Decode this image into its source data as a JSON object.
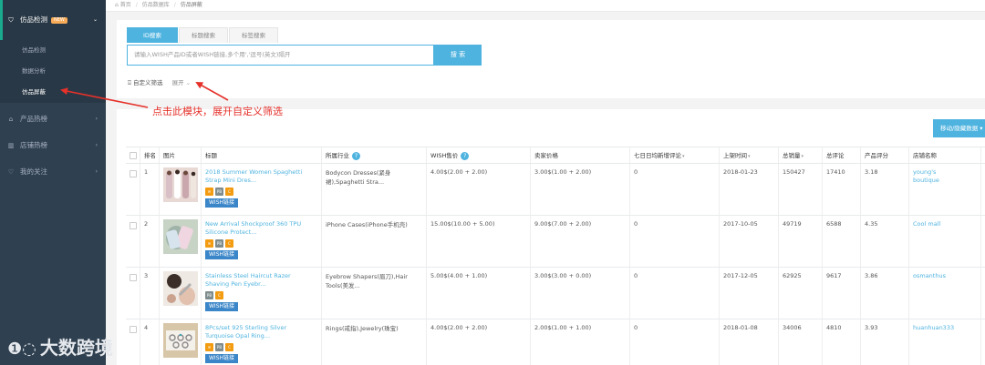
{
  "sidebar": {
    "main_items": [
      {
        "label": "仿品检测",
        "badge": "NEW",
        "icon": "shield-icon"
      },
      {
        "label": "产品热榜",
        "icon": "cart-icon"
      },
      {
        "label": "店铺热榜",
        "icon": "store-icon"
      },
      {
        "label": "我的关注",
        "icon": "heart-icon"
      }
    ],
    "sub_items": [
      {
        "label": "仿品检测"
      },
      {
        "label": "数据分析"
      },
      {
        "label": "仿品屏蔽"
      }
    ],
    "watermark": "大数跨境"
  },
  "breadcrumb": {
    "home": "首页",
    "level1": "仿品数据库",
    "current": "仿品屏蔽"
  },
  "search": {
    "tabs": [
      "ID搜索",
      "标题搜索",
      "标签搜索"
    ],
    "placeholder": "请输入WISH产品ID或者WISH链接,多个用','逗号(英文)隔开",
    "button": "搜 索",
    "custom_filter": "自定义筛选",
    "expand": "展开"
  },
  "annotation": {
    "text": "点击此模块，展开自定义筛选",
    "color": "#e5312a"
  },
  "toolbar": {
    "move_button": "移动/隐藏数据"
  },
  "table": {
    "headers": {
      "rank": "排名",
      "image": "图片",
      "title": "标题",
      "industry": "所属行业",
      "wish_price": "WISH售价",
      "seller_price": "卖家价格",
      "reviews7": "七日日均新增评论",
      "listed": "上架时间",
      "sales": "总销量",
      "total_reviews": "总评论",
      "rating": "产品评分",
      "shop": "店铺名称"
    },
    "wish_link_label": "WISH链接",
    "rows": [
      {
        "rank": "1",
        "title": "2018 Summer Women Spaghetti Strap Mini Dres...",
        "industry": "Bodycon Dresses(紧身裙),Spaghetti Stra...",
        "wish_price": "4.00$(2.00 + 2.00)",
        "seller_price": "3.00$(1.00 + 2.00)",
        "reviews7": "0",
        "listed": "2018-01-23",
        "sales": "150427",
        "total_reviews": "17410",
        "rating": "3.18",
        "shop": "young's boutique"
      },
      {
        "rank": "2",
        "title": "New Arrival Shockproof 360 TPU Silicone Protect...",
        "industry": "iPhone Cases(iPhone手机壳)",
        "wish_price": "15.00$(10.00 + 5.00)",
        "seller_price": "9.00$(7.00 + 2.00)",
        "reviews7": "0",
        "listed": "2017-10-05",
        "sales": "49719",
        "total_reviews": "6588",
        "rating": "4.35",
        "shop": "Cool mall"
      },
      {
        "rank": "3",
        "title": "Stainless Steel Haircut Razer Shaving Pen Eyebr...",
        "industry": "Eyebrow Shapers(眉刀),Hair Tools(美发...",
        "wish_price": "5.00$(4.00 + 1.00)",
        "seller_price": "3.00$(3.00 + 0.00)",
        "reviews7": "0",
        "listed": "2017-12-05",
        "sales": "62925",
        "total_reviews": "9617",
        "rating": "3.86",
        "shop": "osmanthus"
      },
      {
        "rank": "4",
        "title": "8Pcs/set 925 Sterling Silver Turquoise Opal Ring...",
        "industry": "Rings(戒指),Jewelry(珠宝)",
        "wish_price": "4.00$(2.00 + 2.00)",
        "seller_price": "2.00$(1.00 + 1.00)",
        "reviews7": "0",
        "listed": "2018-01-08",
        "sales": "34006",
        "total_reviews": "4810",
        "rating": "3.93",
        "shop": "huanhuan333"
      }
    ]
  },
  "colors": {
    "sidebar": "#2f4050",
    "accent": "#4fb3df",
    "wish_button": "#3b86c8",
    "annotation": "#e5312a"
  }
}
